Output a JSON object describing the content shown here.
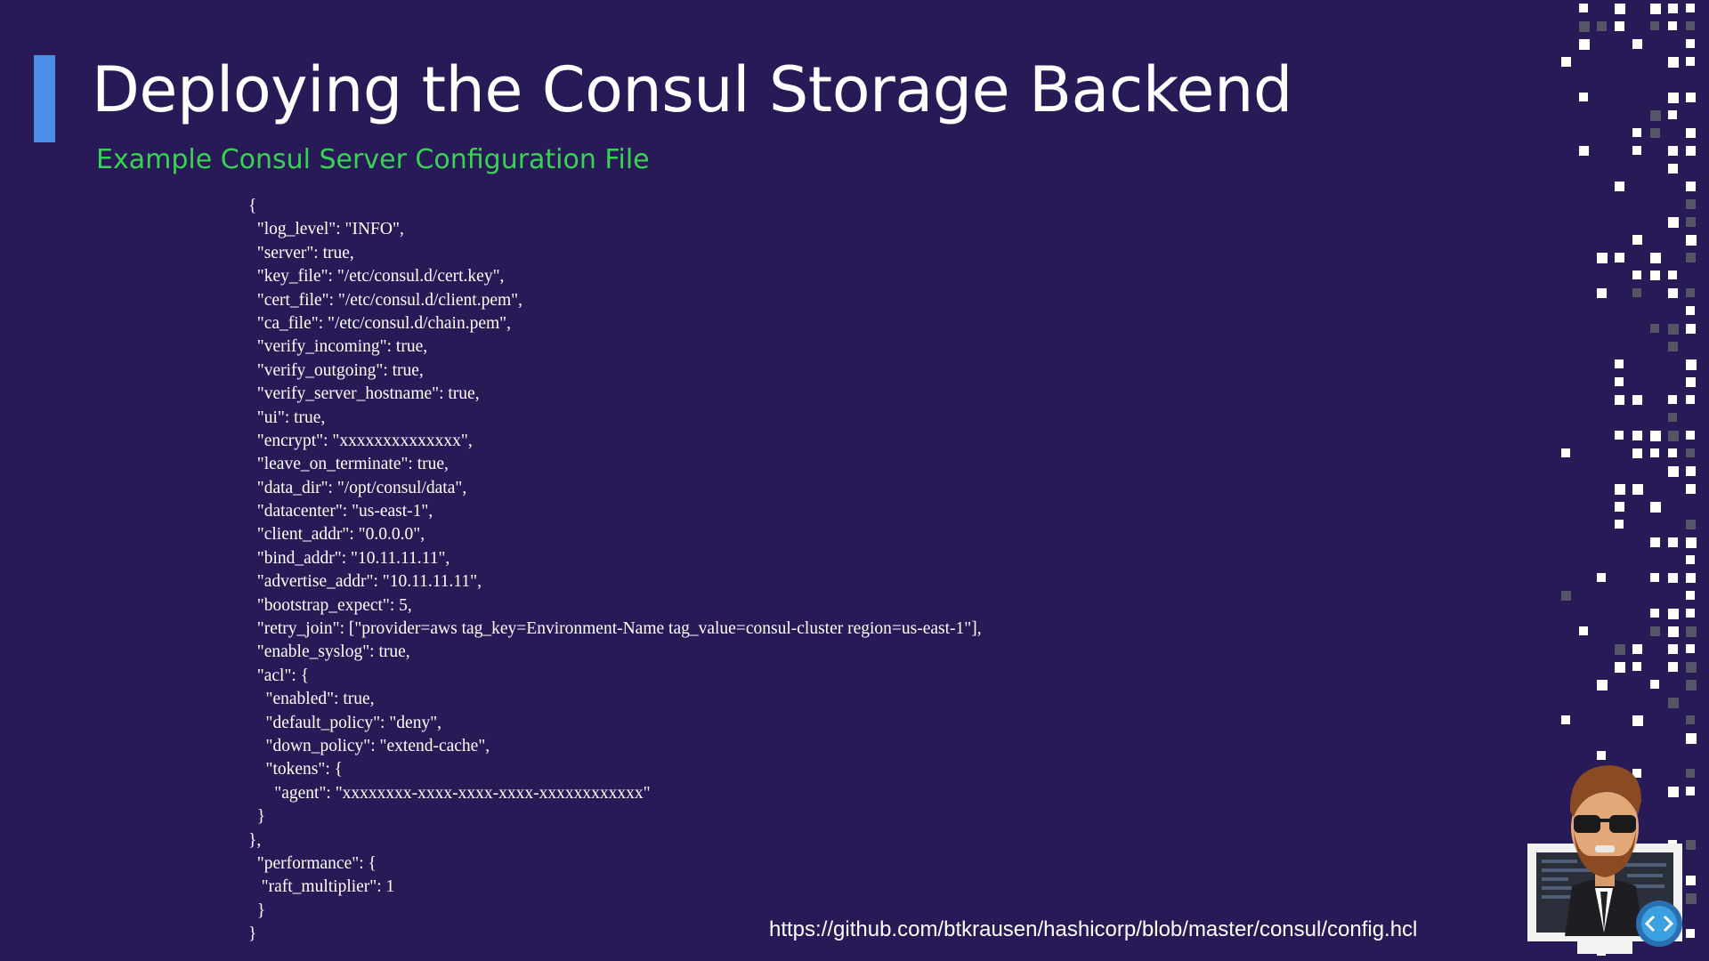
{
  "slide": {
    "title": "Deploying the Consul Storage Backend",
    "subtitle": "Example Consul Server Configuration File",
    "source_url": "https://github.com/btkrausen/hashicorp/blob/master/consul/config.hcl",
    "accent_color": "#4c8ee6",
    "subtitle_color": "#39d353",
    "background_color": "#271a57"
  },
  "code": {
    "lines": [
      "{",
      "  \"log_level\": \"INFO\",",
      "  \"server\": true,",
      "  \"key_file\": \"/etc/consul.d/cert.key\",",
      "  \"cert_file\": \"/etc/consul.d/client.pem\",",
      "  \"ca_file\": \"/etc/consul.d/chain.pem\",",
      "  \"verify_incoming\": true,",
      "  \"verify_outgoing\": true,",
      "  \"verify_server_hostname\": true,",
      "  \"ui\": true,",
      "  \"encrypt\": \"xxxxxxxxxxxxxx\",",
      "  \"leave_on_terminate\": true,",
      "  \"data_dir\": \"/opt/consul/data\",",
      "  \"datacenter\": \"us-east-1\",",
      "  \"client_addr\": \"0.0.0.0\",",
      "  \"bind_addr\": \"10.11.11.11\",",
      "  \"advertise_addr\": \"10.11.11.11\",",
      "  \"bootstrap_expect\": 5,",
      "  \"retry_join\": [\"provider=aws tag_key=Environment-Name tag_value=consul-cluster region=us-east-1\"],",
      "  \"enable_syslog\": true,",
      "  \"acl\": {",
      "    \"enabled\": true,",
      "    \"default_policy\": \"deny\",",
      "    \"down_policy\": \"extend-cache\",",
      "    \"tokens\": {",
      "      \"agent\": \"xxxxxxxx-xxxx-xxxx-xxxx-xxxxxxxxxxxx\"",
      "  }",
      "},",
      "  \"performance\": {",
      "   \"raft_multiplier\": 1",
      "  }",
      "}"
    ]
  },
  "decorations": {
    "pixel_pattern_icon": "pixel-grid-pattern",
    "mascot_icon": "instructor-avatar-with-monitor",
    "badge_icon": "code-brackets-cloud-icon"
  }
}
